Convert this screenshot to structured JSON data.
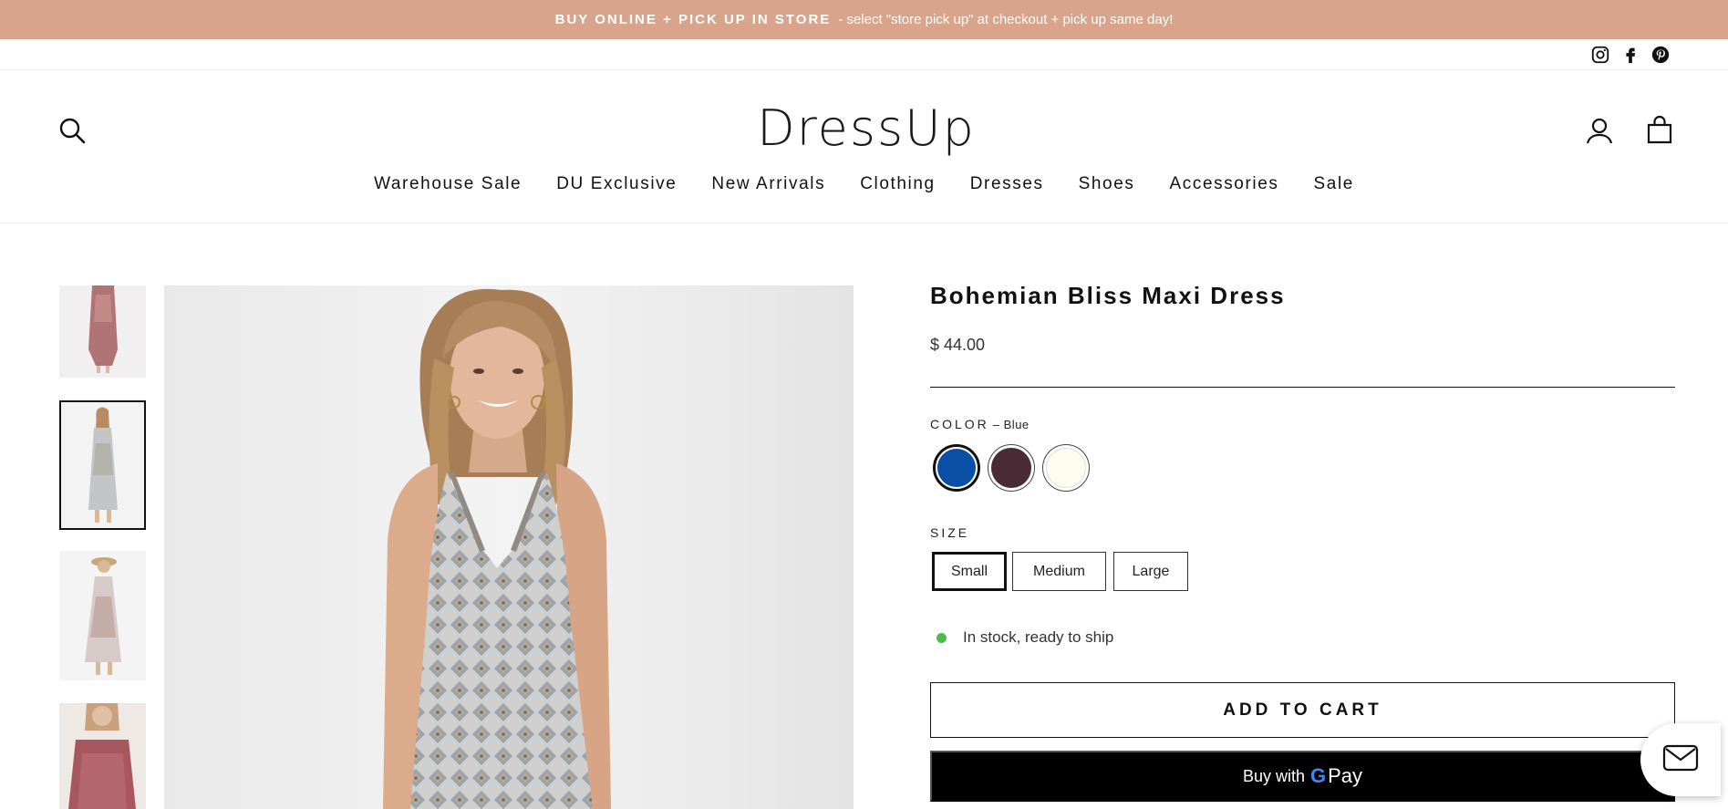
{
  "announcement": {
    "highlight": "BUY ONLINE + PICK UP IN STORE",
    "text": "- select \"store pick up\" at checkout + pick up same day!"
  },
  "social": {
    "icons": [
      "instagram-icon",
      "facebook-icon",
      "pinterest-icon"
    ]
  },
  "header": {
    "logo": "DressUp",
    "icons": [
      "search-icon",
      "account-icon",
      "cart-icon"
    ]
  },
  "nav": {
    "items": [
      "Warehouse Sale",
      "DU Exclusive",
      "New Arrivals",
      "Clothing",
      "Dresses",
      "Shoes",
      "Accessories",
      "Sale"
    ]
  },
  "product": {
    "title": "Bohemian Bliss Maxi Dress",
    "price": "$ 44.00",
    "color_label": "COLOR",
    "color_selected": "– Blue",
    "colors": [
      "#0a4fa6",
      "#4a2a35",
      "#fdfdf0"
    ],
    "size_label": "SIZE",
    "sizes": [
      "Small",
      "Medium",
      "Large"
    ],
    "stock_text": "In stock, ready to ship",
    "add_to_cart": "ADD TO CART",
    "buy_with": "Buy with",
    "gpay_g": "G",
    "gpay_pay": "Pay"
  },
  "colors": {
    "announcement_bg": "#d9a48c",
    "stock_dot": "#4cbd4c"
  }
}
